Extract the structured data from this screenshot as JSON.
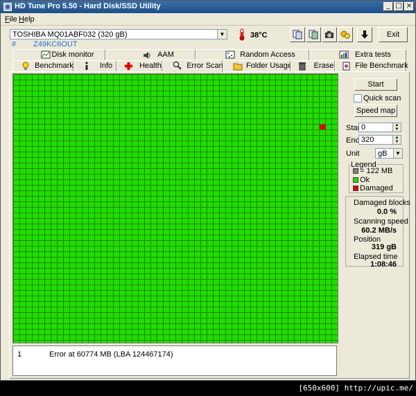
{
  "window": {
    "title": "HD Tune Pro 5.50 - Hard Disk/SSD Utility"
  },
  "menu": [
    {
      "label": "File",
      "key": "F"
    },
    {
      "label": "Help",
      "key": "H"
    }
  ],
  "drive": {
    "selected": "TOSHIBA MQ01ABF032 (320 gB)",
    "hash": "#",
    "serial": "Z49KC6OUT",
    "temperature": "38°C"
  },
  "toolbar": {
    "exit_label": "Exit"
  },
  "tabs_top": [
    "Disk monitor",
    "AAM",
    "Random Access",
    "Extra tests"
  ],
  "tabs_bottom": [
    "Benchmark",
    "Info",
    "Health",
    "Error Scan",
    "Folder Usage",
    "Erase",
    "File Benchmark"
  ],
  "active_tab": "Error Scan",
  "controls": {
    "start_label": "Start",
    "quick_scan_label": "Quick scan",
    "quick_scan_checked": false,
    "speed_map_label": "Speed map",
    "start_field_label": "Start",
    "start_value": "0",
    "end_field_label": "End",
    "end_value": "320",
    "unit_label": "Unit",
    "unit_value": "gB"
  },
  "legend": {
    "title": "Legend",
    "block_size": "= 122 MB",
    "ok": "Ok",
    "damaged": "Damaged",
    "colors": {
      "ok": "#22dd00",
      "damaged": "#e00000",
      "block": "#808080"
    }
  },
  "stats": {
    "damaged_blocks_label": "Damaged blocks",
    "damaged_blocks": "0.0 %",
    "scanning_speed_label": "Scanning speed",
    "scanning_speed": "60.2 MB/s",
    "position_label": "Position",
    "position": "319 gB",
    "elapsed_label": "Elapsed time",
    "elapsed": "1:08:46"
  },
  "scan_map": {
    "damaged_block": {
      "column": 49,
      "row": 9
    }
  },
  "log": [
    {
      "index": "1",
      "message": "Error at 60774 MB (LBA 124467174)"
    }
  ],
  "watermark": "[650x600] http://upic.me/"
}
